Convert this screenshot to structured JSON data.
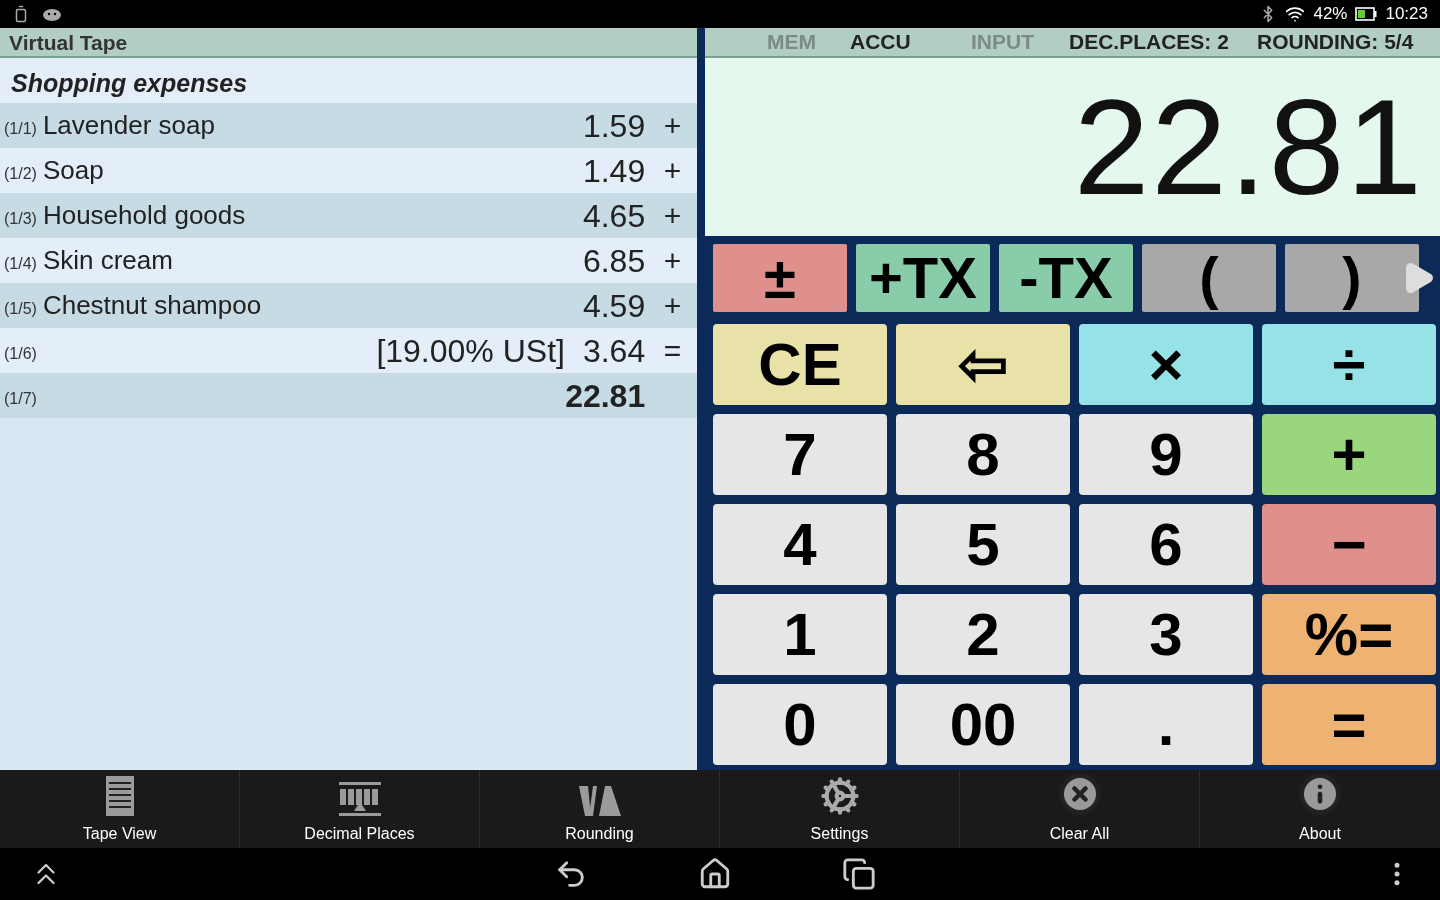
{
  "status_bar": {
    "battery_percent": "42%",
    "time": "10:23"
  },
  "tape": {
    "title": "Virtual Tape",
    "heading": "Shopping expenses",
    "rows": [
      {
        "kind": "item",
        "index": "(1/1)",
        "label": "Lavender soap",
        "amount": "1.59",
        "op": "+"
      },
      {
        "kind": "item",
        "index": "(1/2)",
        "label": "Soap",
        "amount": "1.49",
        "op": "+"
      },
      {
        "kind": "item",
        "index": "(1/3)",
        "label": "Household goods",
        "amount": "4.65",
        "op": "+"
      },
      {
        "kind": "item",
        "index": "(1/4)",
        "label": "Skin cream",
        "amount": "6.85",
        "op": "+"
      },
      {
        "kind": "item",
        "index": "(1/5)",
        "label": "Chestnut shampoo",
        "amount": "4.59",
        "op": "+"
      },
      {
        "kind": "tax",
        "index": "(1/6)",
        "label": "[19.00% USt]",
        "amount": "3.64",
        "op": "="
      },
      {
        "kind": "total",
        "index": "(1/7)",
        "amount": "22.81"
      }
    ]
  },
  "indicators": [
    {
      "label": "MEM",
      "active": false
    },
    {
      "label": "ACCU",
      "active": true
    },
    {
      "label": "INPUT",
      "active": false
    },
    {
      "label": "DEC.PLACES: 2",
      "active": true
    },
    {
      "label": "ROUNDING: 5/4",
      "active": true
    }
  ],
  "display": {
    "value": "22.81"
  },
  "function_keys": [
    {
      "label": "±",
      "color": "#e0908c"
    },
    {
      "label": "+TX",
      "color": "#88ccaa"
    },
    {
      "label": "-TX",
      "color": "#88ccaa"
    },
    {
      "label": "(",
      "color": "#a8a8a8"
    },
    {
      "label": ")",
      "color": "#a8a8a8"
    }
  ],
  "keys": [
    {
      "label": "CE",
      "color": "#e8e2a8"
    },
    {
      "label": "⇦",
      "color": "#e8e2a8"
    },
    {
      "label": "×",
      "color": "#96e2e6"
    },
    {
      "label": "÷",
      "color": "#96e2e6"
    },
    {
      "label": "7",
      "color": "#e6e6e6"
    },
    {
      "label": "8",
      "color": "#e6e6e6"
    },
    {
      "label": "9",
      "color": "#e6e6e6"
    },
    {
      "label": "+",
      "color": "#9ad67e"
    },
    {
      "label": "4",
      "color": "#e6e6e6"
    },
    {
      "label": "5",
      "color": "#e6e6e6"
    },
    {
      "label": "6",
      "color": "#e6e6e6"
    },
    {
      "label": "−",
      "color": "#e0908c"
    },
    {
      "label": "1",
      "color": "#e6e6e6"
    },
    {
      "label": "2",
      "color": "#e6e6e6"
    },
    {
      "label": "3",
      "color": "#e6e6e6"
    },
    {
      "label": "%=",
      "color": "#eeb272"
    },
    {
      "label": "0",
      "color": "#e6e6e6"
    },
    {
      "label": "00",
      "color": "#e6e6e6"
    },
    {
      "label": ".",
      "color": "#e6e6e6"
    },
    {
      "label": "=",
      "color": "#eeb272"
    }
  ],
  "menu": [
    {
      "kind": "tape",
      "label": "Tape View"
    },
    {
      "kind": "decimal",
      "label": "Decimal Places"
    },
    {
      "kind": "rounding",
      "label": "Rounding"
    },
    {
      "kind": "settings",
      "label": "Settings"
    },
    {
      "kind": "clear",
      "label": "Clear All"
    },
    {
      "kind": "about",
      "label": "About"
    }
  ]
}
